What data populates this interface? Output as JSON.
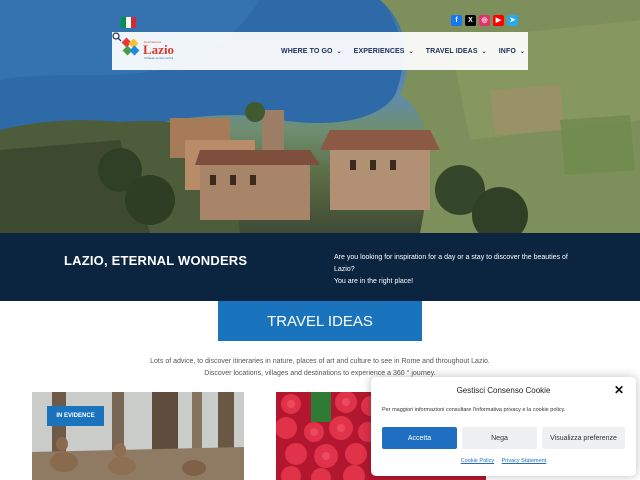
{
  "header": {
    "flag_colors": [
      "#009246",
      "#ffffff",
      "#ce2b37"
    ],
    "socials": [
      {
        "icon": "facebook-icon",
        "glyph": "f",
        "color": "#1877f2"
      },
      {
        "icon": "x-icon",
        "glyph": "X",
        "color": "#000000"
      },
      {
        "icon": "instagram-icon",
        "glyph": "◎",
        "color": "#e1306c"
      },
      {
        "icon": "youtube-icon",
        "glyph": "▶",
        "color": "#ff0000"
      },
      {
        "icon": "telegram-icon",
        "glyph": "➤",
        "color": "#29a9eb"
      }
    ],
    "logo": {
      "top_text": "Destinazione",
      "word": "Lazio",
      "sub_text": "Il Paese senza confini"
    },
    "menu": [
      {
        "label": "WHERE TO GO",
        "chevron": "⌄"
      },
      {
        "label": "EXPERIENCES",
        "chevron": "⌄"
      },
      {
        "label": "TRAVEL IDEAS",
        "chevron": "⌄"
      },
      {
        "label": "INFO",
        "chevron": "⌄"
      }
    ]
  },
  "band": {
    "title": "LAZIO, ETERNAL WONDERS",
    "text_line1": "Are you looking for inspiration for a day or a stay to discover the beauties of Lazio?",
    "text_line2": "You are in the right place!"
  },
  "travel_ideas": {
    "button_label": "TRAVEL IDEAS",
    "intro_line1": "Lots of advice, to discover itineraries in nature, places of art and culture to see in Rome and throughout Lazio.",
    "intro_line2": "Discover locations, villages and destinations to experience a 360 ° journey."
  },
  "cards": {
    "badge": "IN EVIDENCE"
  },
  "consent": {
    "title": "Gestisci Consenso Cookie",
    "close": "✕",
    "text": "Per maggiori informazioni consultare l'informativa privacy e la cookie policy.",
    "accept": "Accetta",
    "deny": "Nega",
    "preferences": "Visualizza preferenze",
    "link_cookie": "Cookie Policy",
    "link_privacy": "Privacy Statement"
  },
  "colors": {
    "accent": "#1a74bd",
    "navy": "#0b2540"
  }
}
